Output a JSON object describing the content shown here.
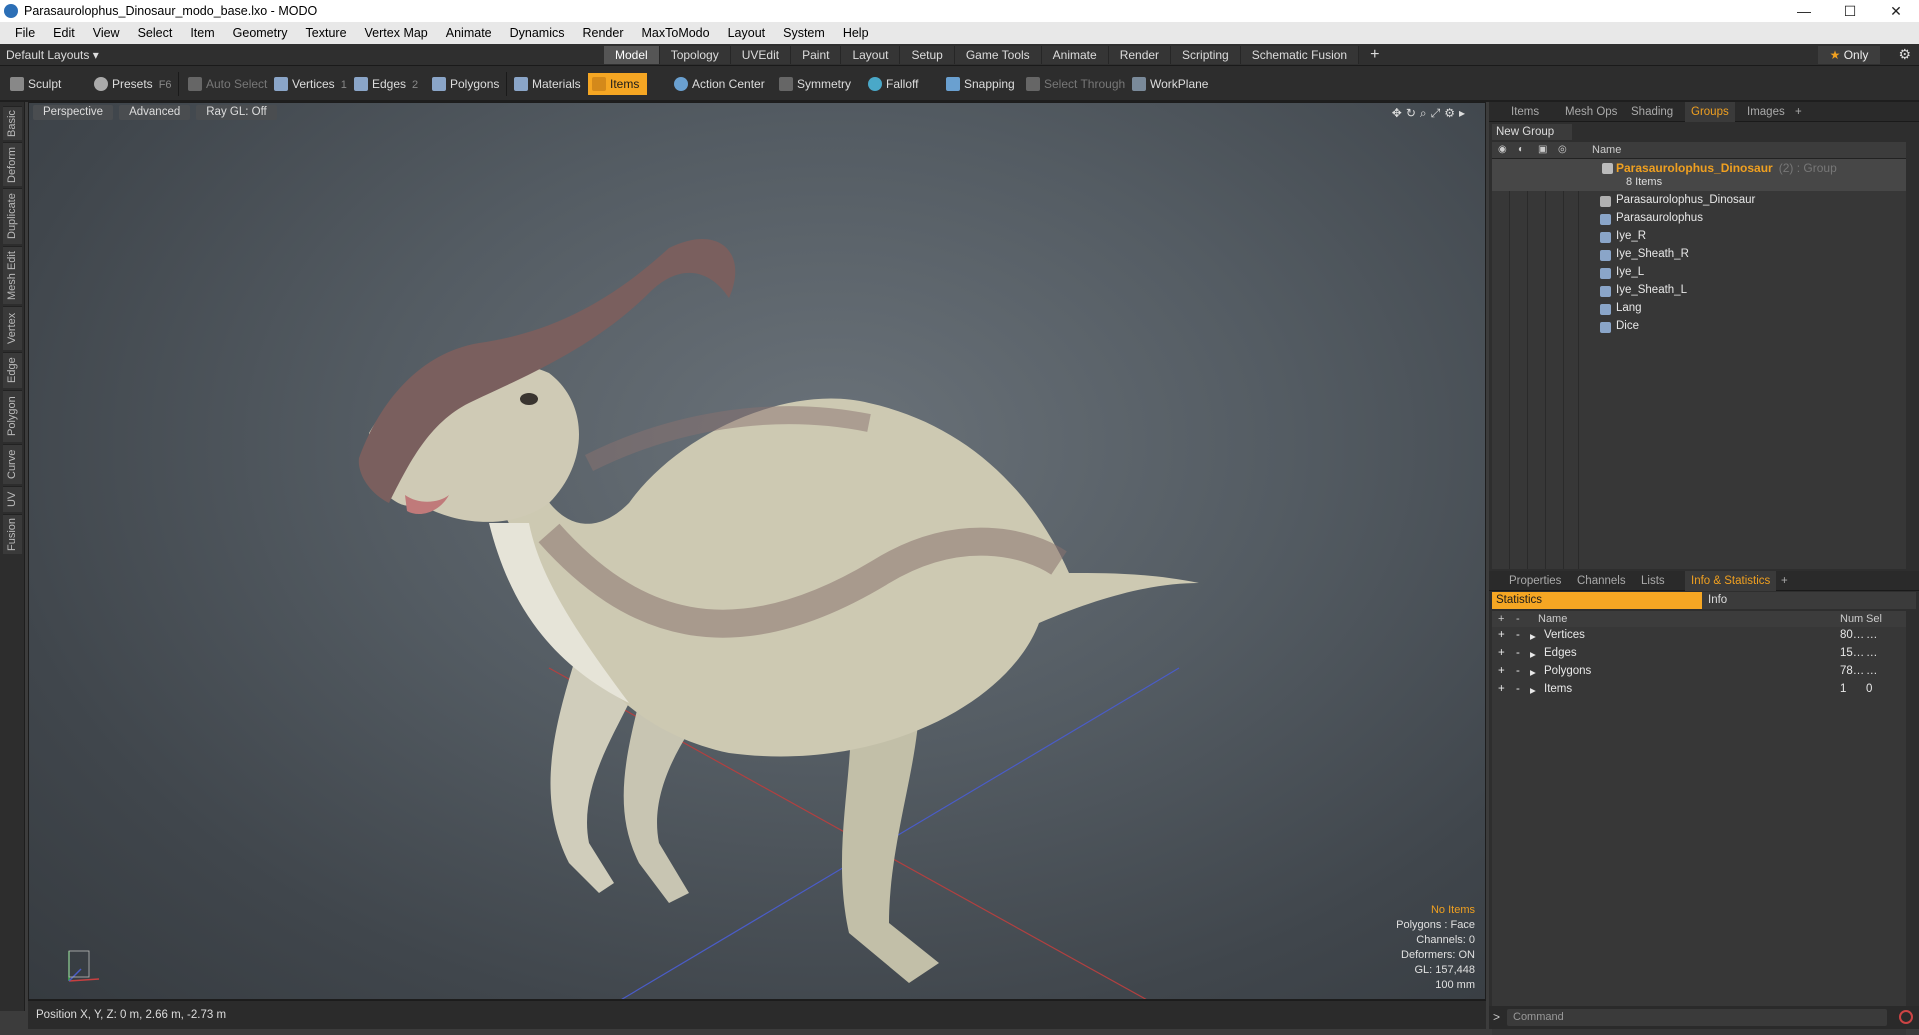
{
  "window": {
    "title": "Parasaurolophus_Dinosaur_modo_base.lxo - MODO",
    "controls": [
      "—",
      "☐",
      "✕"
    ]
  },
  "menu": [
    "File",
    "Edit",
    "View",
    "Select",
    "Item",
    "Geometry",
    "Texture",
    "Vertex Map",
    "Animate",
    "Dynamics",
    "Render",
    "MaxToModo",
    "Layout",
    "System",
    "Help"
  ],
  "layout_bar": {
    "layout_name": "Default Layouts ▾",
    "tabs": [
      "Model",
      "Topology",
      "UVEdit",
      "Paint",
      "Layout",
      "Setup",
      "Game Tools",
      "Animate",
      "Render",
      "Scripting",
      "Schematic Fusion"
    ],
    "active_tab": "Model",
    "only_label": "Only"
  },
  "toolbar": {
    "sculpt": "Sculpt",
    "presets": "Presets",
    "presets_key": "F6",
    "auto_select": "Auto Select",
    "vertices": "Vertices",
    "vertices_key": "1",
    "edges": "Edges",
    "edges_key": "2",
    "polygons": "Polygons",
    "materials": "Materials",
    "items": "Items",
    "action_center": "Action Center",
    "symmetry": "Symmetry",
    "falloff": "Falloff",
    "snapping": "Snapping",
    "select_through": "Select Through",
    "workplane": "WorkPlane"
  },
  "left_tabs": [
    "Basic",
    "Deform",
    "Duplicate",
    "Mesh Edit",
    "Vertex",
    "Edge",
    "Polygon",
    "Curve",
    "UV",
    "Fusion"
  ],
  "viewport": {
    "view": "Perspective",
    "advanced": "Advanced",
    "raygl": "Ray GL: Off",
    "hud": {
      "selection": "No Items",
      "polygons": "Polygons : Face",
      "channels": "Channels: 0",
      "deformers": "Deformers: ON",
      "gl": "GL: 157,448",
      "scale": "100 mm"
    }
  },
  "status": {
    "position": "Position X, Y, Z:  0 m, 2.66 m, -2.73 m"
  },
  "top_panel": {
    "tabs": [
      "Items",
      "Mesh Ops",
      "Shading",
      "Groups",
      "Images"
    ],
    "active": "Groups",
    "new_group": "New Group",
    "col_name": "Name",
    "group": {
      "name": "Parasaurolophus_Dinosaur",
      "meta": "(2) : Group",
      "count": "8 Items"
    },
    "items": [
      "Parasaurolophus_Dinosaur",
      "Parasaurolophus",
      "Iye_R",
      "Iye_Sheath_R",
      "Iye_L",
      "Iye_Sheath_L",
      "Lang",
      "Dice"
    ]
  },
  "bottom_panel": {
    "tabs": [
      "Properties",
      "Channels",
      "Lists",
      "Info & Statistics"
    ],
    "active": "Info & Statistics",
    "statistics": "Statistics",
    "info": "Info",
    "columns": {
      "name": "Name",
      "num": "Num",
      "sel": "Sel"
    },
    "rows": [
      {
        "name": "Vertices",
        "num": "80…",
        "sel": "…"
      },
      {
        "name": "Edges",
        "num": "15…",
        "sel": "…"
      },
      {
        "name": "Polygons",
        "num": "78…",
        "sel": "…"
      },
      {
        "name": "Items",
        "num": "1",
        "sel": "0"
      }
    ]
  },
  "command": {
    "prompt": ">",
    "placeholder": "Command"
  },
  "colors": {
    "accent": "#f5a623",
    "group_name": "#f0a020"
  }
}
